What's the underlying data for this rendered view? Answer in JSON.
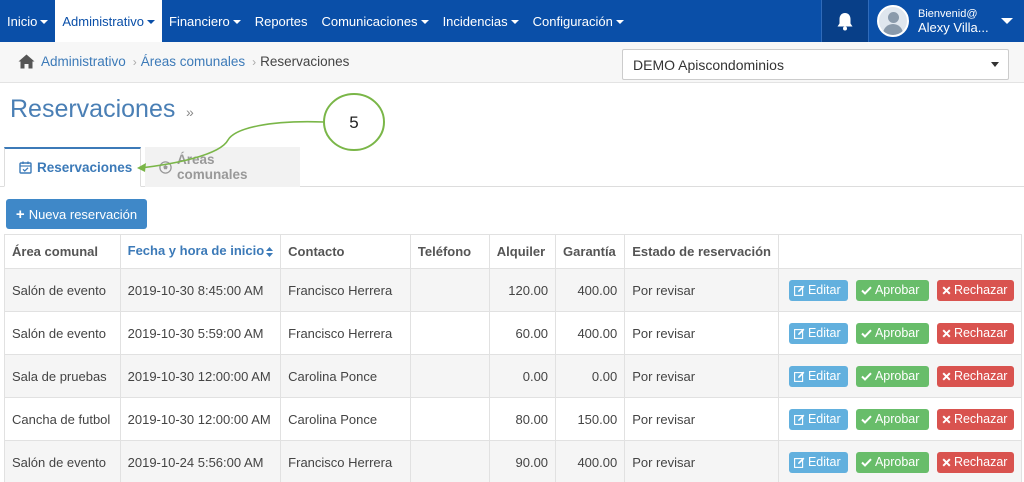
{
  "nav": {
    "items": [
      {
        "label": "Inicio",
        "caret": true
      },
      {
        "label": "Administrativo",
        "caret": true,
        "active": true
      },
      {
        "label": "Financiero",
        "caret": true
      },
      {
        "label": "Reportes",
        "caret": false
      },
      {
        "label": "Comunicaciones",
        "caret": true
      },
      {
        "label": "Incidencias",
        "caret": true
      },
      {
        "label": "Configuración",
        "caret": true
      }
    ],
    "user_greeting": "Bienvenid@",
    "user_name": "Alexy Villa..."
  },
  "breadcrumb": {
    "items": [
      "Administrativo",
      "Áreas comunales",
      "Reservaciones"
    ]
  },
  "condo_select": {
    "value": "DEMO Apiscondominios"
  },
  "page": {
    "title": "Reservaciones",
    "title_suffix": "»"
  },
  "tabs": [
    {
      "label": "Reservaciones",
      "icon": "calendar-check-icon"
    },
    {
      "label": "Áreas comunales",
      "icon": "soccer-ball-icon"
    }
  ],
  "annotation": {
    "number": "5"
  },
  "new_button": {
    "label": "Nueva reservación"
  },
  "table": {
    "headers": [
      "Área comunal",
      "Fecha y hora de inicio",
      "Contacto",
      "Teléfono",
      "Alquiler",
      "Garantía",
      "Estado de reservación",
      ""
    ],
    "sorted_column": 1,
    "rows": [
      {
        "area": "Salón de evento",
        "fecha": "2019-10-30 8:45:00 AM",
        "contacto": "Francisco Herrera",
        "telefono": "",
        "alquiler": "120.00",
        "garantia": "400.00",
        "estado": "Por revisar"
      },
      {
        "area": "Salón de evento",
        "fecha": "2019-10-30 5:59:00 AM",
        "contacto": "Francisco Herrera",
        "telefono": "",
        "alquiler": "60.00",
        "garantia": "400.00",
        "estado": "Por revisar"
      },
      {
        "area": "Sala de pruebas",
        "fecha": "2019-10-30 12:00:00 AM",
        "contacto": "Carolina Ponce",
        "telefono": "",
        "alquiler": "0.00",
        "garantia": "0.00",
        "estado": "Por revisar"
      },
      {
        "area": "Cancha de futbol",
        "fecha": "2019-10-30 12:00:00 AM",
        "contacto": "Carolina Ponce",
        "telefono": "",
        "alquiler": "80.00",
        "garantia": "150.00",
        "estado": "Por revisar"
      },
      {
        "area": "Salón de evento",
        "fecha": "2019-10-24 5:56:00 AM",
        "contacto": "Francisco Herrera",
        "telefono": "",
        "alquiler": "90.00",
        "garantia": "400.00",
        "estado": "Por revisar"
      }
    ],
    "actions": {
      "edit": "Editar",
      "approve": "Aprobar",
      "reject": "Rechazar"
    }
  },
  "colors": {
    "nav_bg": "#0a4fa8",
    "accent": "#3c7ab8",
    "edit": "#62b0de",
    "approve": "#68bd6a",
    "reject": "#d9534f",
    "annotation": "#7ab648"
  }
}
